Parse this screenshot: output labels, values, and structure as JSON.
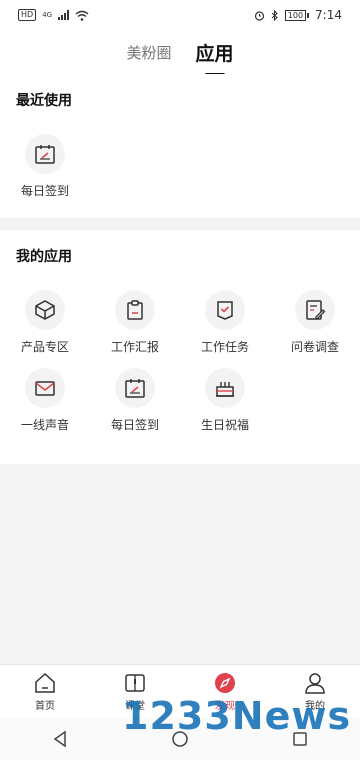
{
  "status_bar": {
    "time": "7:14",
    "battery": "100",
    "hd": "HD",
    "network": "4G"
  },
  "top_tabs": [
    {
      "label": "美粉圈"
    },
    {
      "label": "应用"
    }
  ],
  "recent": {
    "title": "最近使用",
    "items": [
      {
        "label": "每日签到",
        "icon": "calendar-check-icon"
      }
    ]
  },
  "my_apps": {
    "title": "我的应用",
    "items": [
      {
        "label": "产品专区",
        "icon": "box-icon"
      },
      {
        "label": "工作汇报",
        "icon": "clipboard-icon"
      },
      {
        "label": "工作任务",
        "icon": "task-check-icon"
      },
      {
        "label": "问卷调查",
        "icon": "survey-edit-icon"
      },
      {
        "label": "一线声音",
        "icon": "mail-icon"
      },
      {
        "label": "每日签到",
        "icon": "calendar-check-icon"
      },
      {
        "label": "生日祝福",
        "icon": "cake-icon"
      }
    ]
  },
  "bottom_nav": [
    {
      "label": "首页",
      "icon": "home-icon"
    },
    {
      "label": "课堂",
      "icon": "book-icon"
    },
    {
      "label": "发现",
      "icon": "compass-icon",
      "active": true
    },
    {
      "label": "我的",
      "icon": "user-icon"
    }
  ],
  "watermark": {
    "text": "1233News"
  },
  "colors": {
    "accent": "#e0424d",
    "icon_stroke": "#333333"
  }
}
